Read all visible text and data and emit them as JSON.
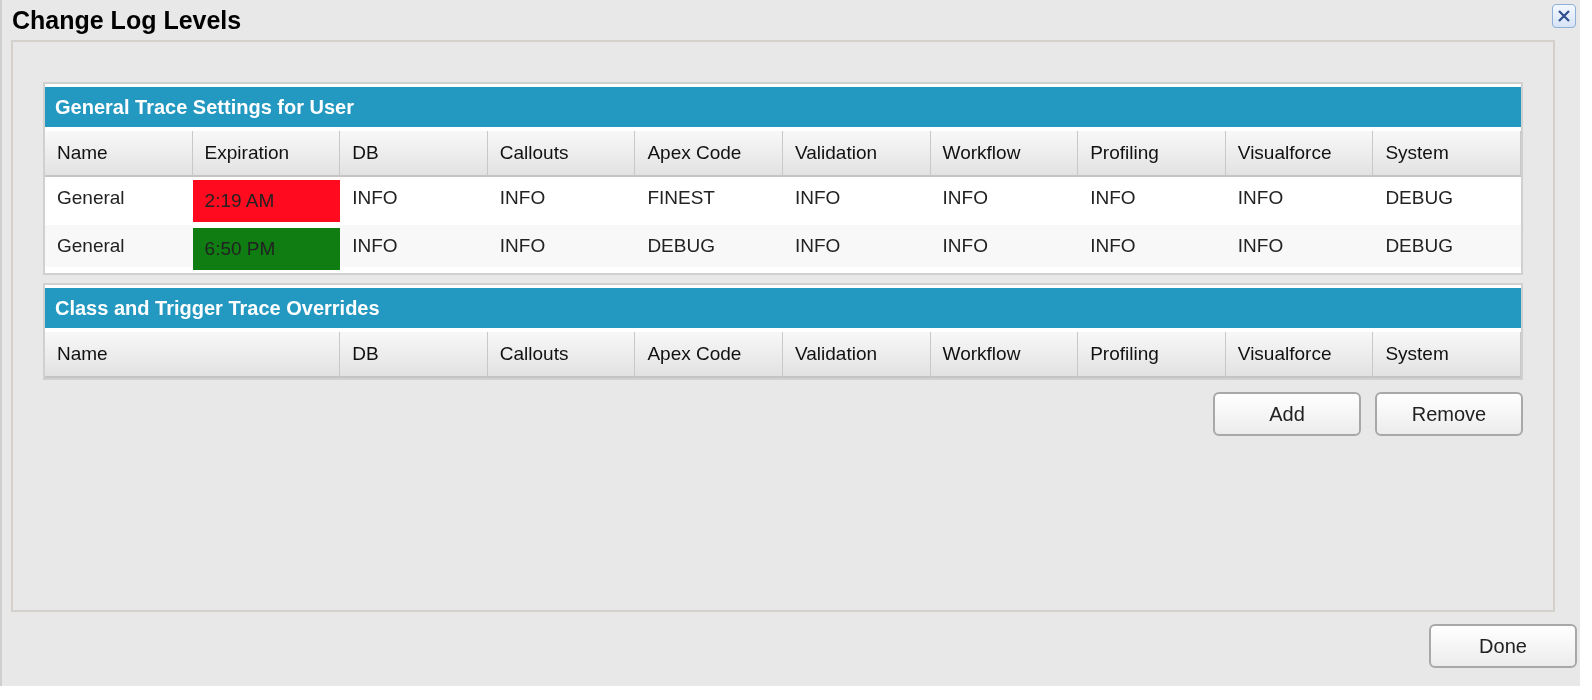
{
  "window": {
    "title": "Change Log Levels"
  },
  "general_settings": {
    "title": "General Trace Settings for User",
    "columns": [
      "Name",
      "Expiration",
      "DB",
      "Callouts",
      "Apex Code",
      "Validation",
      "Workflow",
      "Profiling",
      "Visualforce",
      "System"
    ],
    "rows": [
      {
        "name": "General",
        "expiration": "2:19 AM",
        "color": "#ff0a1e",
        "levels": [
          "INFO",
          "INFO",
          "FINEST",
          "INFO",
          "INFO",
          "INFO",
          "INFO",
          "DEBUG"
        ]
      },
      {
        "name": "General",
        "expiration": "6:50 PM",
        "color": "#0f7d12",
        "levels": [
          "INFO",
          "INFO",
          "DEBUG",
          "INFO",
          "INFO",
          "INFO",
          "INFO",
          "DEBUG"
        ]
      }
    ]
  },
  "overrides": {
    "title": "Class and Trigger Trace Overrides",
    "columns": [
      "Name",
      "DB",
      "Callouts",
      "Apex Code",
      "Validation",
      "Workflow",
      "Profiling",
      "Visualforce",
      "System"
    ],
    "buttons": [
      "Add",
      "Remove"
    ]
  },
  "footer_buttons": [
    "Done"
  ]
}
